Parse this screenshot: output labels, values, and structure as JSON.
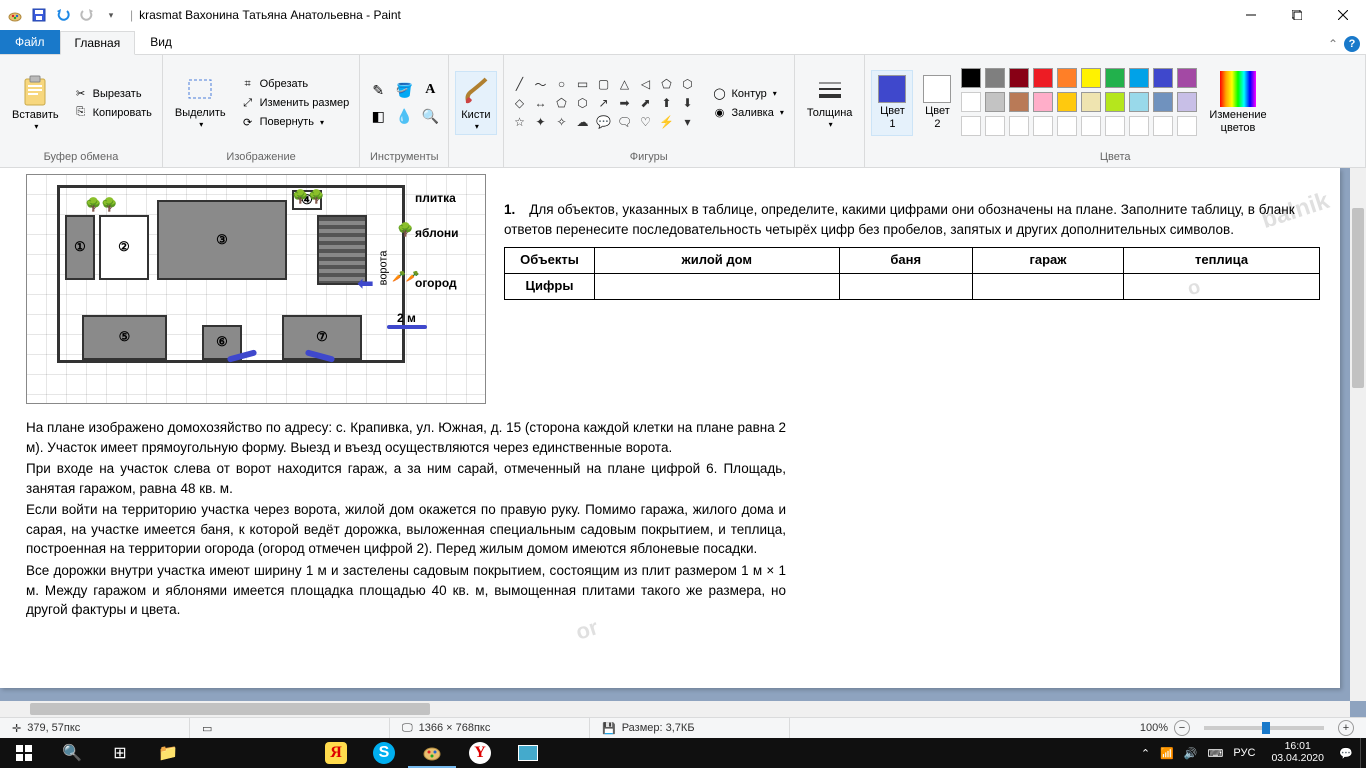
{
  "titlebar": {
    "title": "krasmat Вахонина Татьяна Анатольевна - Paint"
  },
  "menu": {
    "file": "Файл",
    "home": "Главная",
    "view": "Вид"
  },
  "ribbon": {
    "clipboard": {
      "label": "Буфер обмена",
      "paste": "Вставить",
      "cut": "Вырезать",
      "copy": "Копировать"
    },
    "image": {
      "label": "Изображение",
      "select": "Выделить",
      "crop": "Обрезать",
      "resize": "Изменить размер",
      "rotate": "Повернуть"
    },
    "tools": {
      "label": "Инструменты"
    },
    "brushes": {
      "label": "Кисти"
    },
    "shapes": {
      "label": "Фигуры",
      "outline": "Контур",
      "fill": "Заливка"
    },
    "size": {
      "label": "Толщина"
    },
    "colors": {
      "label": "Цвета",
      "color1": "Цвет\n1",
      "color2": "Цвет\n2",
      "edit": "Изменение\nцветов",
      "palette_row1": [
        "#000000",
        "#7f7f7f",
        "#880015",
        "#ed1c24",
        "#ff7f27",
        "#fff200",
        "#22b14c",
        "#00a2e8",
        "#3f48cc",
        "#a349a4"
      ],
      "palette_row2": [
        "#ffffff",
        "#c3c3c3",
        "#b97a57",
        "#ffaec9",
        "#ffc90e",
        "#efe4b0",
        "#b5e61d",
        "#99d9ea",
        "#7092be",
        "#c8bfe7"
      ],
      "palette_row3": [
        "#ffffff",
        "#ffffff",
        "#ffffff",
        "#ffffff",
        "#ffffff",
        "#ffffff",
        "#ffffff",
        "#ffffff",
        "#ffffff",
        "#ffffff"
      ]
    }
  },
  "canvas": {
    "plan_labels": {
      "tile": "плитка",
      "apples": "яблони",
      "garden": "огород",
      "scale": "2 м",
      "gate": "ворота"
    },
    "task": {
      "num": "1.",
      "text": "Для объектов, указанных в таблице, определите, какими цифрами они обозначены на плане. Заполните таблицу, в бланк ответов перенесите последовательность четырёх цифр без пробелов, запятых и других дополнительных символов.",
      "row_objects": "Объекты",
      "row_digits": "Цифры",
      "h_house": "жилой дом",
      "h_bath": "баня",
      "h_garage": "гараж",
      "h_green": "теплица"
    },
    "desc": {
      "p1": "На плане изображено домохозяйство по адресу: с. Крапивка, ул. Южная, д. 15 (сторона каждой клетки на плане равна 2 м). Участок имеет прямоугольную форму. Выезд и въезд осуществляются через единственные ворота.",
      "p2": "При входе на участок слева от ворот находится гараж, а за ним сарай, отмеченный на пла­не цифрой 6. Площадь, занятая гаражом, равна 48 кв. м.",
      "p3": "Если войти на территорию участка через ворота, жилой дом окажется по правую руку. Помимо гаража, жилого дома и сарая, на участке имеется баня, к которой ведёт дорожка, выложенная специальным садовым покрытием, и теплица, построенная на территории огорода (огород отмечен цифрой 2). Перед жилым домом имеются яблоневые посадки.",
      "p4": "Все дорожки внутри участка имеют ширину 1 м и застелены садовым покрытием, состоя­щим из плит размером 1 м × 1 м. Между гаражом и яблонями имеется площадка площа­дью 40 кв. м, вымощенная плитами такого же размера, но другой фактуры и цвета."
    }
  },
  "statusbar": {
    "pos": "379, 57пкс",
    "dim": "1366 × 768пкс",
    "size": "Размер: 3,7КБ",
    "zoom": "100%"
  },
  "taskbar": {
    "lang": "РУС",
    "time": "16:01",
    "date": "03.04.2020"
  }
}
